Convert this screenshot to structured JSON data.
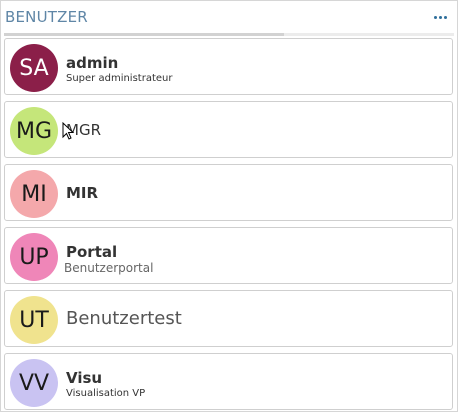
{
  "header": {
    "title": "BENUTZER",
    "menu_icon": "more-dots-icon"
  },
  "users": [
    {
      "initials": "SA",
      "name": "admin",
      "subtitle": "Super administrateur",
      "color": "#8b1f49",
      "text_dark": false
    },
    {
      "initials": "MG",
      "name": "MGR",
      "subtitle": "",
      "color": "#c5e67a",
      "text_dark": true
    },
    {
      "initials": "MI",
      "name": "MIR",
      "subtitle": "",
      "color": "#f4a8ab",
      "text_dark": true
    },
    {
      "initials": "UP",
      "name": "Portal",
      "subtitle": "Benutzerportal",
      "color": "#ef86b8",
      "text_dark": true
    },
    {
      "initials": "UT",
      "name": "Benutzertest",
      "subtitle": "",
      "color": "#f0e38e",
      "text_dark": true
    },
    {
      "initials": "VV",
      "name": "Visu",
      "subtitle": "Visualisation VP",
      "color": "#c9c3f2",
      "text_dark": true
    }
  ]
}
